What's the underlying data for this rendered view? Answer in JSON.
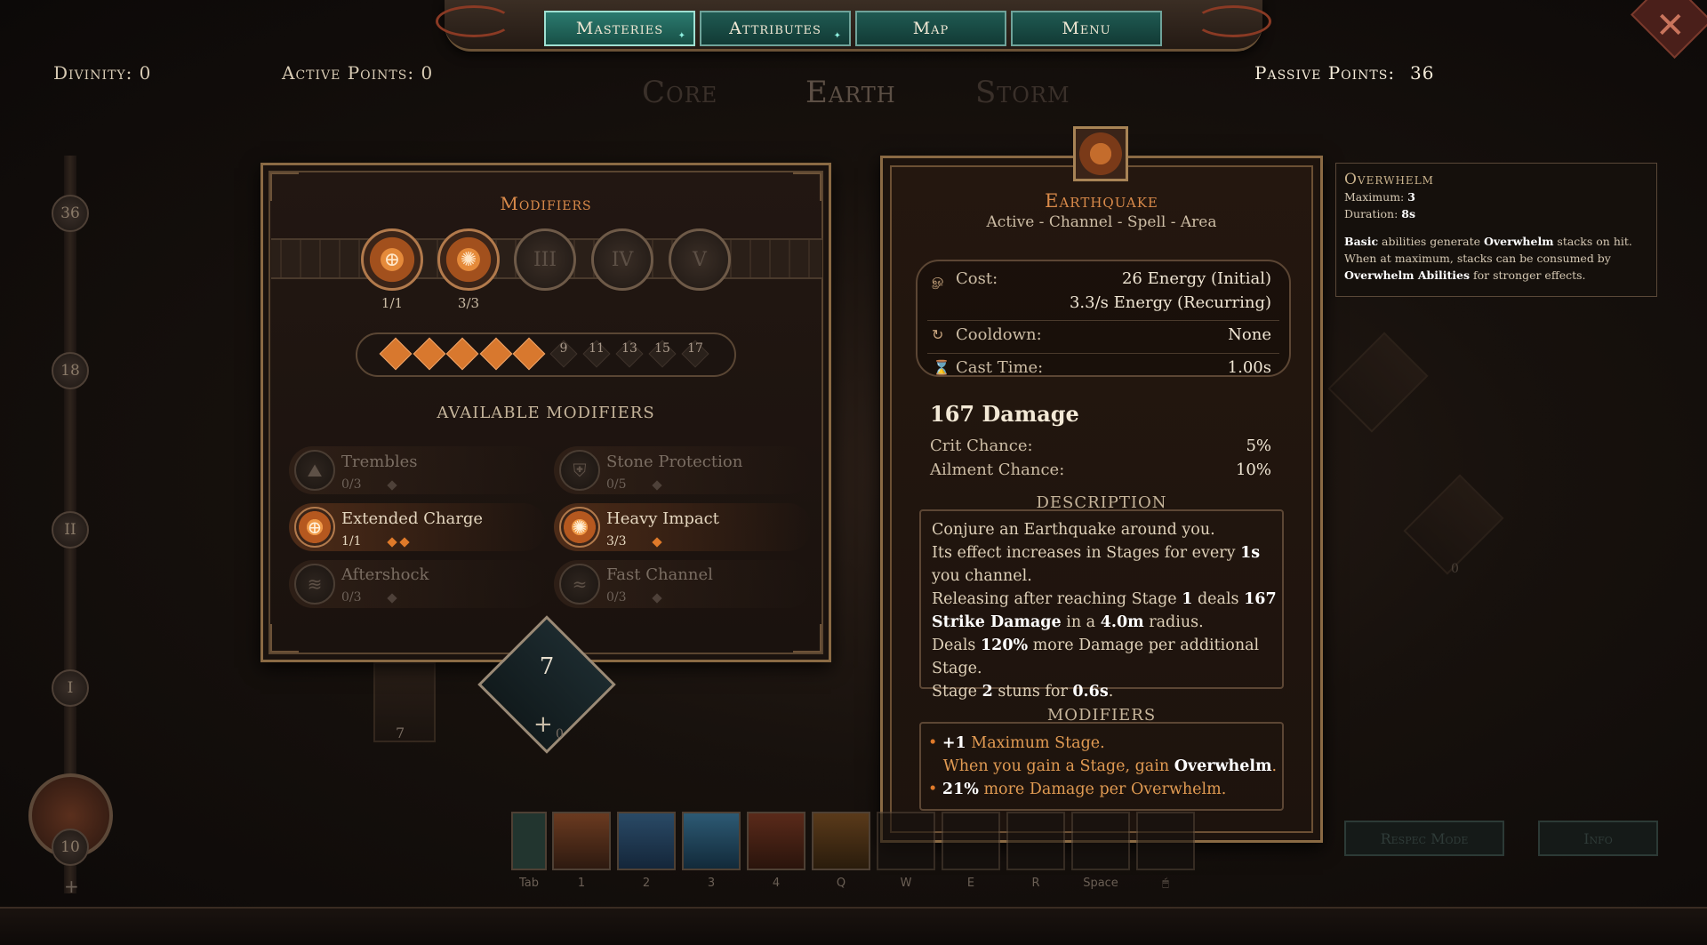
{
  "nav": {
    "tabs": [
      {
        "label": "Masteries"
      },
      {
        "label": "Attributes"
      },
      {
        "label": "Map"
      },
      {
        "label": "Menu"
      }
    ],
    "close_icon": "close-icon"
  },
  "header": {
    "divinity": "Divinity: 0",
    "active_points": "Active Points: 0",
    "passive_points_label": "Passive Points:",
    "passive_points_value": "36"
  },
  "tree_tabs": [
    {
      "label": "Core"
    },
    {
      "label": "Earth"
    },
    {
      "label": "Storm"
    }
  ],
  "slider": {
    "marks": [
      "36",
      "18",
      "II",
      "I",
      "10"
    ]
  },
  "modifiers_panel": {
    "title": "Modifiers",
    "slots": [
      {
        "label": "1/1",
        "icon": "target-icon"
      },
      {
        "label": "3/3",
        "icon": "impact-icon"
      },
      {
        "label": "III",
        "icon": "slot-iii"
      },
      {
        "label": "IV",
        "icon": "slot-iv"
      },
      {
        "label": "V",
        "icon": "slot-v"
      }
    ],
    "pip_numbers": [
      "9",
      "11",
      "13",
      "15",
      "17"
    ],
    "filled_pips": 5,
    "available_title": "AVAILABLE MODIFIERS",
    "modifiers": [
      {
        "name": "Trembles",
        "count": "0/3"
      },
      {
        "name": "Stone Protection",
        "count": "0/5"
      },
      {
        "name": "Extended Charge",
        "count": "1/1"
      },
      {
        "name": "Heavy Impact",
        "count": "3/3"
      },
      {
        "name": "Aftershock",
        "count": "0/3"
      },
      {
        "name": "Fast Channel",
        "count": "0/3"
      }
    ],
    "level": "7"
  },
  "bg_nodes": {
    "left_count": "7",
    "right_count": "0",
    "badge_count": "0"
  },
  "skill": {
    "name": "Earthquake",
    "tags": "Active - Channel - Spell - Area",
    "cost_label": "Cost:",
    "cost_value_1": "26 Energy (Initial)",
    "cost_value_2": "3.3/s Energy (Recurring)",
    "cooldown_label": "Cooldown:",
    "cooldown_value": "None",
    "cast_label": "Cast Time:",
    "cast_value": "1.00s",
    "damage": "167 Damage",
    "crit_label": "Crit Chance:",
    "crit_value": "5%",
    "ailment_label": "Ailment Chance:",
    "ailment_value": "10%",
    "description_title": "DESCRIPTION",
    "description": [
      "Conjure an Earthquake around you.",
      "Its effect increases in Stages for every ",
      "1s",
      " you channel.",
      "Releasing after reaching Stage ",
      "1",
      " deals ",
      "167 Strike Damage",
      " in a ",
      "4.0m",
      " radius.",
      "Deals ",
      "120%",
      " more Damage per additional Stage.",
      "Stage ",
      "2",
      " stuns for ",
      "0.6s",
      "."
    ],
    "modifiers_title": "MODIFIERS",
    "mod_lines": {
      "l1_bold": "+1",
      "l1_rest": " Maximum Stage.",
      "l2_pre": "When you gain a Stage, gain ",
      "l2_bold": "Overwhelm",
      "l2_post": ".",
      "l3_bold": "21%",
      "l3_rest": " more Damage per Overwhelm."
    }
  },
  "tooltip": {
    "title": "Overwhelm",
    "max_label": "Maximum: ",
    "max_value": "3",
    "dur_label": "Duration: ",
    "dur_value": "8s",
    "line1_bold": "Basic",
    "line1_mid": " abilities generate ",
    "line1_bold2": "Overwhelm",
    "line1_end": " stacks on hit.",
    "line2_pre": "When at maximum, stacks can be consumed by ",
    "line2_bold": "Overwhelm Abilities",
    "line2_end": " for stronger effects."
  },
  "hotbar": {
    "keys": [
      "Tab",
      "1",
      "2",
      "3",
      "4",
      "Q",
      "W",
      "E",
      "R",
      "Space",
      "mouse-icon"
    ]
  },
  "buttons": {
    "respec": "Respec Mode",
    "info": "Info"
  },
  "colors": {
    "accent": "#d98a4a",
    "teal_tab": "#1f5a52",
    "pip": "#d8782e",
    "panel_border": "#8a6a44"
  }
}
